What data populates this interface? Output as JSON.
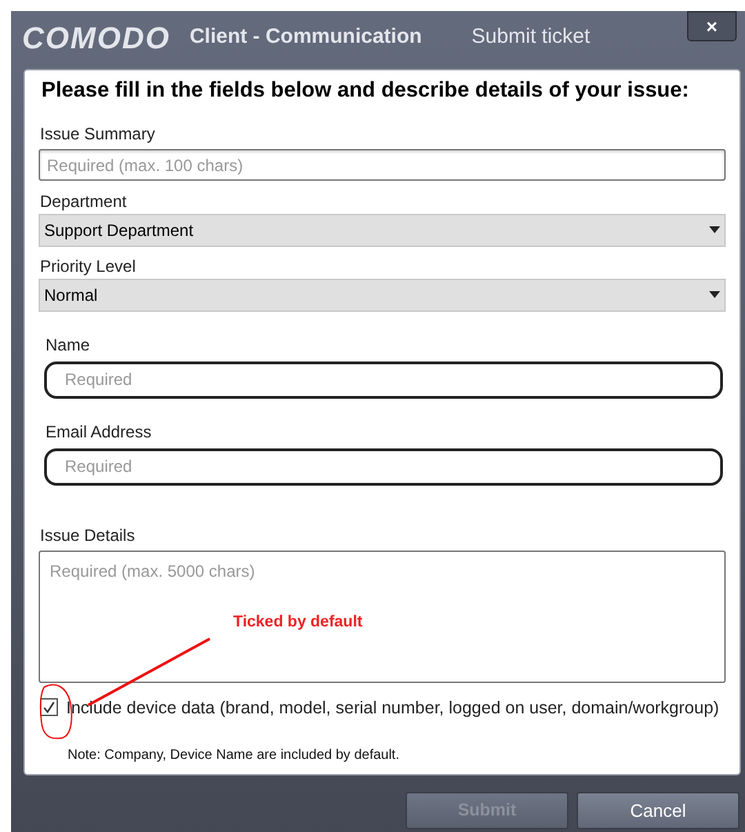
{
  "window": {
    "logo": "COMODO",
    "title": "Client - Communication",
    "subtitle": "Submit ticket",
    "close": "×"
  },
  "heading": "Please fill in the fields below and describe details of your issue:",
  "fields": [
    {
      "label": "Issue Summary",
      "kind": "text",
      "placeholder": "Required (max. 100 chars)"
    },
    {
      "label": "Department",
      "kind": "select",
      "value": "Support Department"
    },
    {
      "label": "Priority Level",
      "kind": "select",
      "value": "Normal"
    },
    {
      "label": "Name",
      "kind": "pill",
      "placeholder": "Required"
    },
    {
      "label": "Email Address",
      "kind": "pill",
      "placeholder": "Required"
    },
    {
      "label": "Issue Details",
      "kind": "area",
      "placeholder": "Required (max. 5000 chars)"
    }
  ],
  "device_data": {
    "label": "Include device data (brand, model, serial number, logged on user, domain/workgroup)",
    "checked": true
  },
  "note": "Note: Company, Device Name  are included by default.",
  "annotation": "Ticked by default",
  "buttons": [
    {
      "label": "Submit",
      "disabled": true
    },
    {
      "label": "Cancel",
      "disabled": false
    }
  ]
}
